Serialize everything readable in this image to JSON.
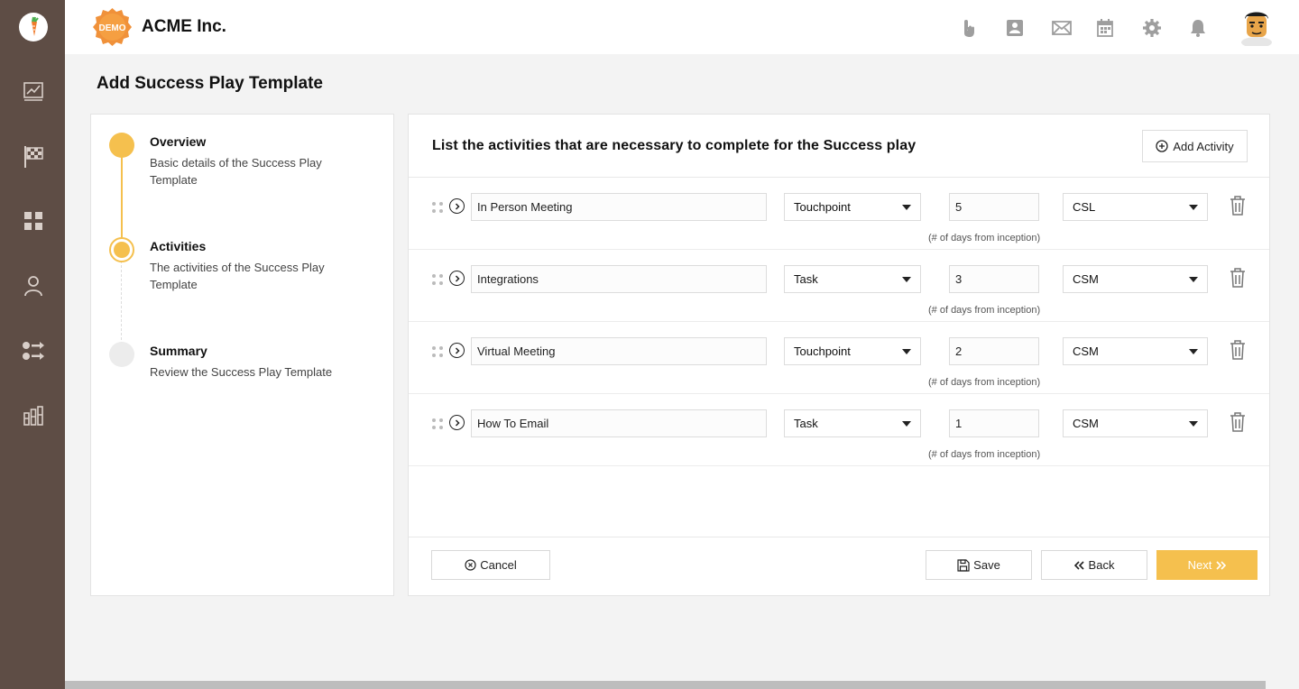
{
  "app": {
    "company": "ACME Inc.",
    "badge": "DEMO",
    "sidebar": [
      "analytics-icon",
      "flag-icon",
      "grid-icon",
      "user-icon",
      "workflow-icon",
      "reports-icon"
    ],
    "header_icons": [
      "touch-icon",
      "contacts-icon",
      "mail-icon",
      "calendar-icon",
      "settings-icon",
      "bell-icon"
    ]
  },
  "page": {
    "title": "Add Success Play Template"
  },
  "steps": [
    {
      "title": "Overview",
      "desc": "Basic details of the Success Play Template",
      "state": "done"
    },
    {
      "title": "Activities",
      "desc": "The activities of the Success Play Template",
      "state": "current"
    },
    {
      "title": "Summary",
      "desc": "Review the Success Play Template",
      "state": "pending"
    }
  ],
  "main": {
    "title": "List the activities that are necessary to complete for the Success play",
    "add_label": "Add Activity",
    "hint": "(# of days from inception)",
    "activities": [
      {
        "name": "In Person Meeting",
        "type": "Touchpoint",
        "days": "5",
        "role": "CSL"
      },
      {
        "name": "Integrations",
        "type": "Task",
        "days": "3",
        "role": "CSM"
      },
      {
        "name": "Virtual Meeting",
        "type": "Touchpoint",
        "days": "2",
        "role": "CSM"
      },
      {
        "name": "How To Email",
        "type": "Task",
        "days": "1",
        "role": "CSM"
      }
    ]
  },
  "footer": {
    "cancel": "Cancel",
    "save": "Save",
    "back": "Back",
    "next": "Next"
  },
  "colors": {
    "sidebar": "#5e4d45",
    "accent": "#f5c04e"
  }
}
